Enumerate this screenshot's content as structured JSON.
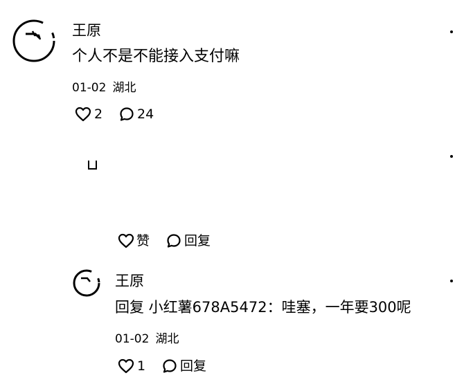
{
  "comment": {
    "author": "王原",
    "text": "个人不是不能接入支付嘛",
    "date": "01-02",
    "location": "湖北",
    "likes": "2",
    "replies": "24"
  },
  "sub_actions": {
    "like_label": "赞",
    "reply_label": "回复"
  },
  "reply": {
    "author": "王原",
    "text": "回复 小红薯678A5472：哇塞，一年要300呢",
    "date": "01-02",
    "location": "湖北",
    "likes": "1",
    "reply_label": "回复"
  },
  "icons": {
    "like": "heart-outline-icon",
    "comment": "comment-bubble-icon",
    "more": "more-dots-icon"
  },
  "colors": {
    "text": "#000000",
    "background": "#ffffff"
  }
}
